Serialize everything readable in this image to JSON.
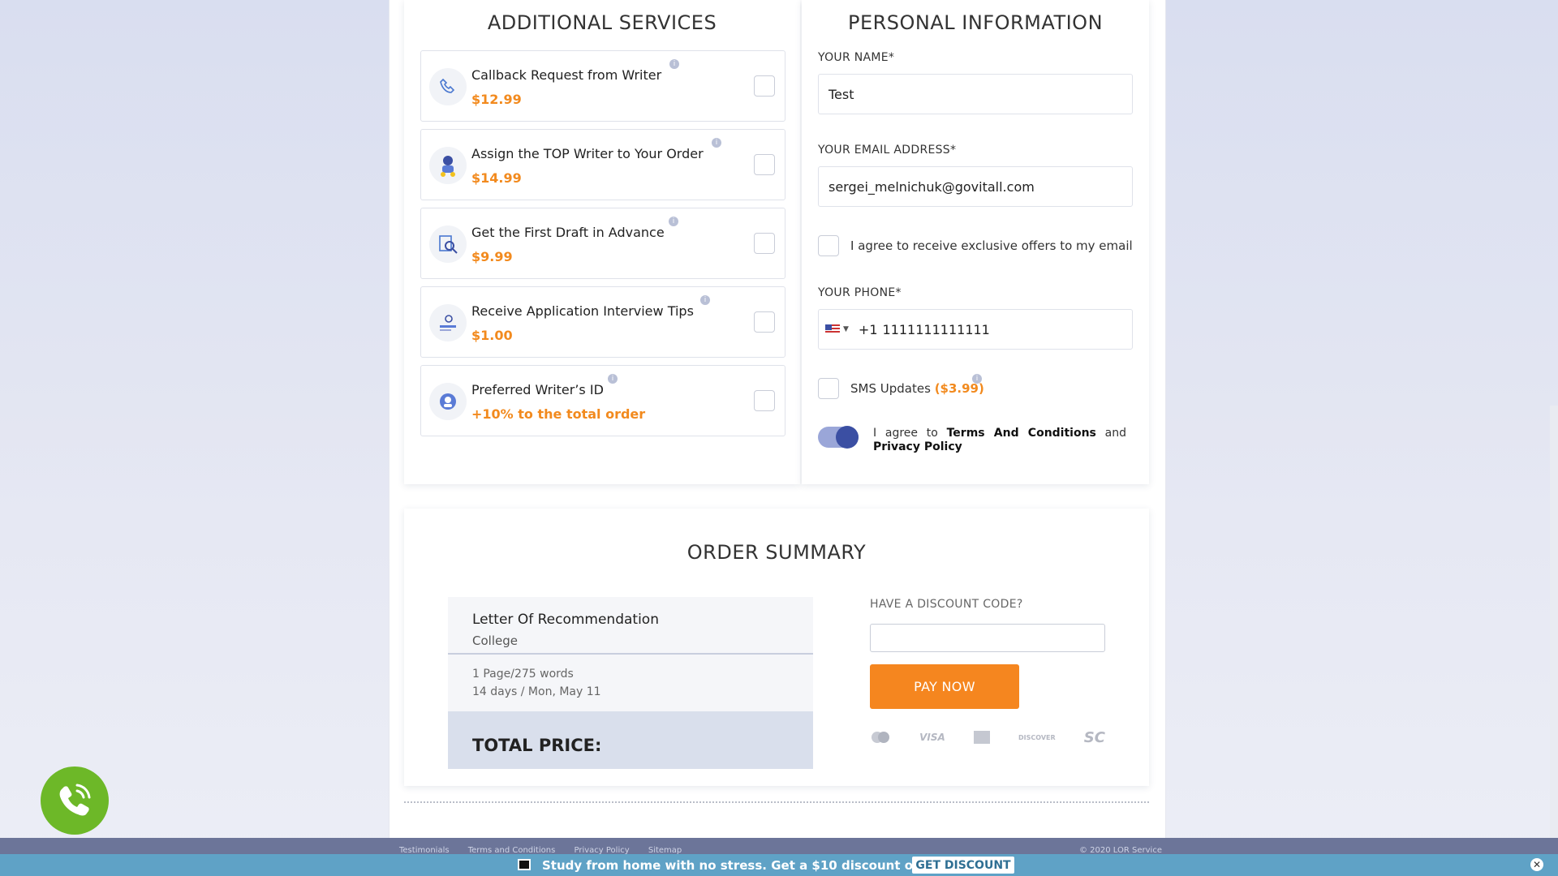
{
  "services": {
    "title": "ADDITIONAL SERVICES",
    "items": [
      {
        "title": "Callback Request from Writer",
        "price": "$12.99",
        "icon": "phone-icon"
      },
      {
        "title": "Assign the TOP Writer to Your Order",
        "price": "$14.99",
        "icon": "top-writer-icon"
      },
      {
        "title": "Get the First Draft in Advance",
        "price": "$9.99",
        "icon": "draft-search-icon"
      },
      {
        "title": "Receive Application Interview Tips",
        "price": "$1.00",
        "icon": "tips-icon"
      },
      {
        "title": "Preferred Writer’s ID",
        "price": "+10% to the total order",
        "icon": "writer-id-icon"
      }
    ]
  },
  "personal": {
    "title": "PERSONAL INFORMATION",
    "name_label": "YOUR NAME*",
    "name_value": "Test",
    "email_label": "YOUR EMAIL ADDRESS*",
    "email_value": "sergei_melnichuk@govitall.com",
    "offers_label": "I agree to receive exclusive offers to my email",
    "phone_label": "YOUR PHONE*",
    "phone_code": "+1",
    "phone_value": "1111111111111",
    "sms_label": "SMS Updates",
    "sms_price": "($3.99)",
    "agree_prefix": "I agree to",
    "terms": "Terms And Conditions",
    "and": "and",
    "privacy": "Privacy Policy"
  },
  "summary": {
    "title": "ORDER SUMMARY",
    "order_title": "Letter Of Recommendation",
    "order_level": "College",
    "pages": "1 Page/275 words",
    "deadline": "14 days / Mon, May 11",
    "total_label": "TOTAL PRICE:",
    "discount_label": "HAVE A DISCOUNT CODE?",
    "discount_value": "",
    "pay_button": "PAY NOW",
    "cards": [
      "mastercard-icon",
      "VISA",
      "amex-icon",
      "DISCOVER",
      "SC"
    ]
  },
  "footer": {
    "links": [
      "Testimonials",
      "Terms and Conditions",
      "Privacy Policy",
      "Sitemap"
    ],
    "copyright": "© 2020 LOR Service"
  },
  "promo": {
    "text": "Study from home with no stress. Get a $10 discount on any paper!",
    "button": "GET DISCOUNT"
  },
  "colors": {
    "accent_orange": "#f28a1e",
    "toggle_blue": "#3b4fa3",
    "promo_bar": "#5fa2c6",
    "call_green": "#6db828"
  }
}
